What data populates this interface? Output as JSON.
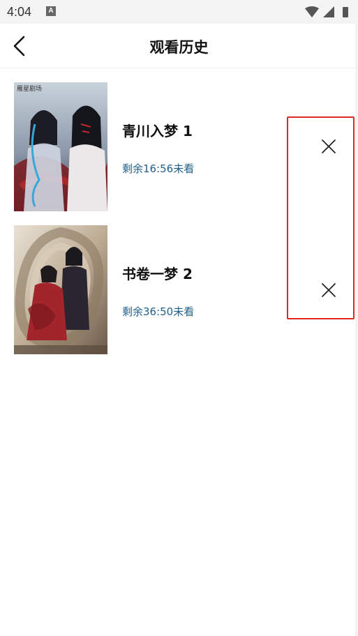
{
  "status_bar": {
    "time": "4:04",
    "notification_icon": "A"
  },
  "header": {
    "title": "观看历史"
  },
  "history": [
    {
      "title": "青川入梦 1",
      "remaining": "剩余16:56未看",
      "poster_text": "雁星剧场"
    },
    {
      "title": "书卷一梦 2",
      "remaining": "剩余36:50未看"
    }
  ],
  "colors": {
    "accent_blue": "#1d5f8a",
    "highlight_red": "#e02a1f"
  }
}
